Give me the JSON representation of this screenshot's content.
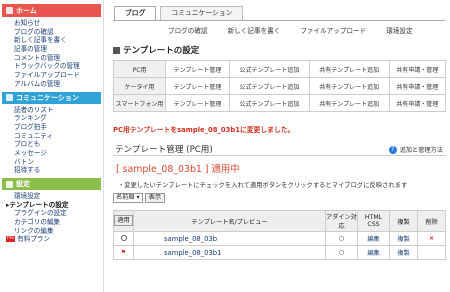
{
  "sidebar": {
    "home": {
      "title": "ホーム",
      "items": [
        "お知らせ",
        "ブログの確認",
        "新しく記事を書く",
        "記事の管理",
        "コメントの管理",
        "トラックバックの管理",
        "ファイルアップロード",
        "アルバムの管理"
      ]
    },
    "community": {
      "title": "コミュニケーション",
      "items": [
        "読者のリスト",
        "ランキング",
        "ブログ拍手",
        "コミュニティ",
        "プロとも",
        "メッセージ",
        "バトン",
        "招待する"
      ]
    },
    "settings": {
      "title": "設定",
      "items": [
        "環境設定",
        "テンプレートの設定",
        "プラグインの設定",
        "カテゴリの編集",
        "リンクの編集"
      ],
      "current": "テンプレートの設定",
      "pro_badge": "Pro",
      "pro_label": "有料プラン"
    }
  },
  "tabs": [
    "ブログ",
    "コミュニケーション"
  ],
  "subnav": [
    "ブログの確認",
    "新しく記事を書く",
    "ファイルアップロード",
    "環境設定"
  ],
  "section_title": "テンプレートの設定",
  "grid": [
    {
      "row": "PC用",
      "cells": [
        "テンプレート管理",
        "公式テンプレート追加",
        "共有テンプレート追加",
        "共有申請・管理"
      ]
    },
    {
      "row": "ケータイ用",
      "cells": [
        "テンプレート管理",
        "公式テンプレート追加",
        "共有テンプレート追加",
        "共有申請・管理"
      ]
    },
    {
      "row": "スマートフォン用",
      "cells": [
        "テンプレート管理",
        "公式テンプレート追加",
        "共有テンプレート追加",
        "共有申請・管理"
      ]
    }
  ],
  "notice": "PC用テンプレートをsample_08_03b1に変更しました。",
  "template_title": "テンプレート管理 (PC用)",
  "help": "追加と管理方法",
  "applied": "[ sample_08_03b1 ] 適用中",
  "instruction": "・変更したいテンプレートにチェックを入れて適用ボタンをクリックするとマイブログに反映されます",
  "sort_select": "名前順",
  "show_button": "表示",
  "table": {
    "headers": [
      "適用",
      "テンプレート名/プレビュー",
      "アダイン対応",
      "HTML CSS",
      "複製",
      "削除"
    ],
    "rows": [
      {
        "apply": "○",
        "name": "sample_08_03b",
        "adain": "○",
        "html": "編集",
        "copy": "複製",
        "delete": "×"
      },
      {
        "apply": "⚑",
        "name": "sample_08_03b1",
        "adain": "○",
        "html": "編集",
        "copy": "複製",
        "delete": ""
      }
    ]
  },
  "colors": {
    "home": "#e8554e",
    "community": "#2fa3d8",
    "settings": "#8dbd4a",
    "notice": "#d23020"
  }
}
